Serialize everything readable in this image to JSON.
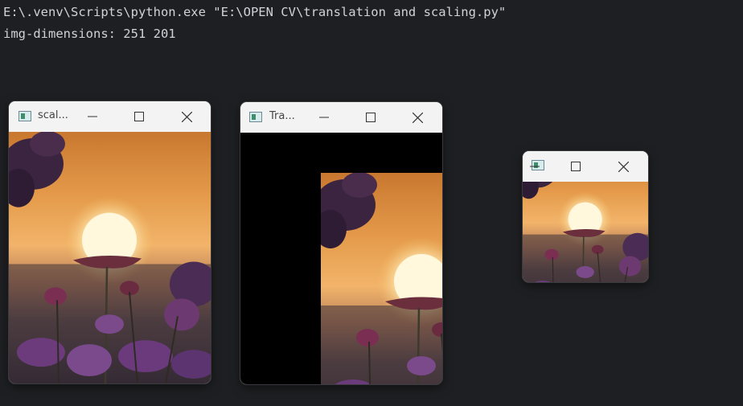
{
  "console": {
    "command": "E:\\.venv\\Scripts\\python.exe \"E:\\OPEN CV\\translation and scaling.py\"",
    "output": "img-dimensions: 251 201"
  },
  "windows": {
    "scaled": {
      "title": "scal..."
    },
    "translated": {
      "title": "Tra..."
    },
    "small": {
      "title": ""
    }
  },
  "colors": {
    "console_bg": "#1e1f22",
    "console_text": "#cfd2d6",
    "titlebar_bg": "#f3f3f3",
    "translate_fill": "#000000"
  },
  "icons": [
    "opencv-window-icon",
    "minimize-icon",
    "maximize-icon",
    "close-icon"
  ]
}
